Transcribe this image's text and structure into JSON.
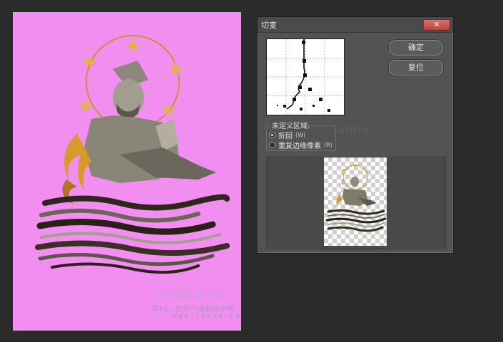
{
  "canvas": {
    "background_color": "#f28ef0",
    "watermark": {
      "title": "PS教程自学网",
      "subtitle": "学PS，就到PS教程自学网",
      "url": "WWW.16XX8.COM"
    }
  },
  "dialog": {
    "title": "切变",
    "close_icon": "close-x-icon",
    "buttons": {
      "ok": "确定",
      "reset": "复位"
    },
    "undefined_area": {
      "label": "未定义区域:",
      "options": [
        {
          "label": "折回",
          "hotkey": "(W)",
          "selected": true
        },
        {
          "label": "重复边缘像素",
          "hotkey": "(R)",
          "selected": false
        }
      ]
    },
    "stamp_text": "ulilia"
  }
}
